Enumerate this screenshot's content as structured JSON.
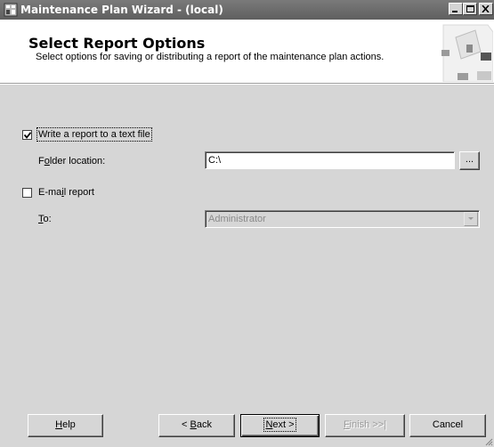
{
  "window": {
    "title": "Maintenance Plan Wizard - (local)",
    "controls": [
      "minimize-icon",
      "maximize-icon",
      "close-icon"
    ]
  },
  "header": {
    "title": "Select Report Options",
    "subtitle": "Select options for saving or distributing a report of the maintenance plan actions."
  },
  "form": {
    "write_report": {
      "label": "Write a report to a text file",
      "checked": true
    },
    "folder_location": {
      "label_pre": "F",
      "label_accel": "o",
      "label_post": "lder location:",
      "value": "C:\\"
    },
    "browse_label": "...",
    "email_report": {
      "label_pre": "E-ma",
      "label_accel": "i",
      "label_post": "l report",
      "checked": false
    },
    "to": {
      "label_accel": "T",
      "label_post": "o:",
      "value": "Administrator",
      "enabled": false
    }
  },
  "buttons": {
    "help": {
      "accel": "H",
      "rest": "elp"
    },
    "back": {
      "pre": "< ",
      "accel": "B",
      "rest": "ack"
    },
    "next": {
      "accel": "N",
      "rest": "ext >"
    },
    "finish": {
      "accel": "F",
      "rest": "inish >>|",
      "enabled": false
    },
    "cancel": {
      "label": "Cancel"
    }
  }
}
